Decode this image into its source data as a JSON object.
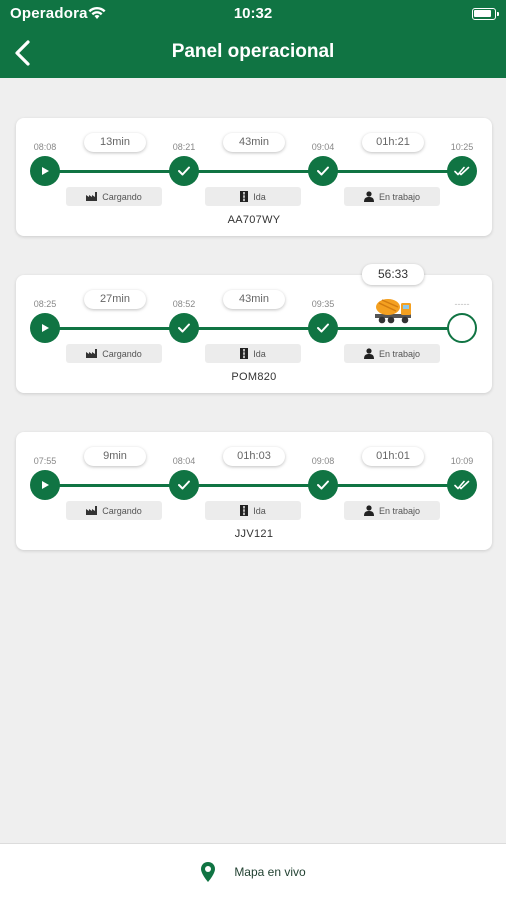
{
  "status_bar": {
    "carrier": "Operadora",
    "time": "10:32"
  },
  "header": {
    "title": "Panel operacional"
  },
  "trips": [
    {
      "plate": "AA707WY",
      "times": [
        "08:08",
        "08:21",
        "09:04",
        "10:25"
      ],
      "durations": [
        "13min",
        "43min",
        "01h:21"
      ],
      "phases": [
        "Cargando",
        "Ida",
        "En trabajo"
      ]
    },
    {
      "plate": "POM820",
      "live_timer": "56:33",
      "times": [
        "08:25",
        "08:52",
        "09:35",
        "-----"
      ],
      "durations": [
        "27min",
        "43min"
      ],
      "phases": [
        "Cargando",
        "Ida",
        "En trabajo"
      ]
    },
    {
      "plate": "JJV121",
      "times": [
        "07:55",
        "08:04",
        "09:08",
        "10:09"
      ],
      "durations": [
        "9min",
        "01h:03",
        "01h:01"
      ],
      "phases": [
        "Cargando",
        "Ida",
        "En trabajo"
      ]
    }
  ],
  "bottom_bar": {
    "label": "Mapa en vivo"
  },
  "colors": {
    "primary": "#107443",
    "background": "#efefef",
    "truck": "#f4a020"
  },
  "icons": {
    "back": "chevron-left-icon",
    "wifi": "wifi-icon",
    "battery": "battery-icon",
    "start": "play-icon",
    "done": "check-icon",
    "finished": "double-check-icon",
    "pending": "empty-circle-icon",
    "loading": "factory-icon",
    "trip": "road-icon",
    "work": "worker-icon",
    "truck": "cement-mixer-truck-icon",
    "map": "map-pin-icon"
  }
}
